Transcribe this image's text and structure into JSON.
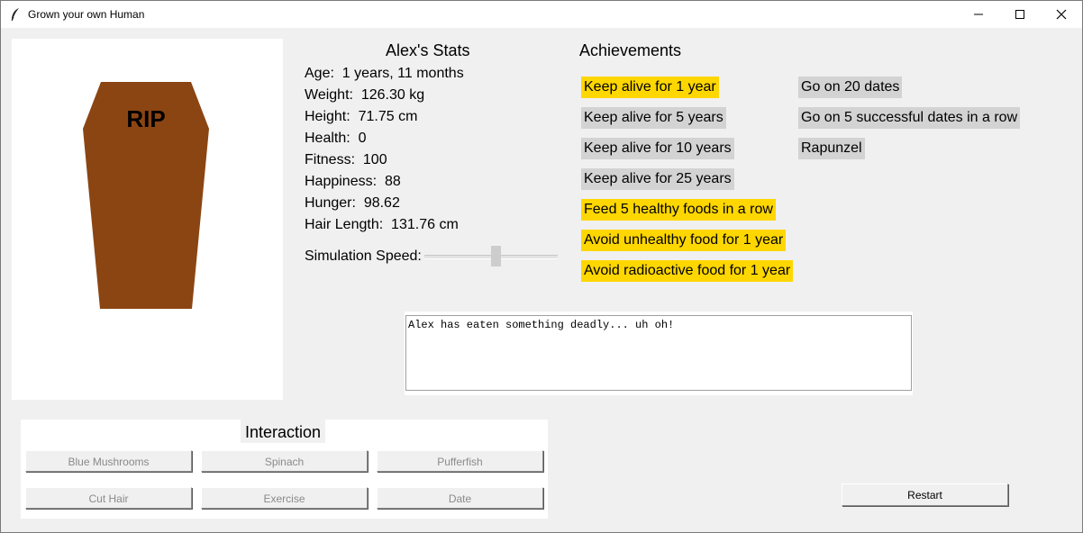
{
  "window": {
    "title": "Grown your own Human"
  },
  "canvas": {
    "tombstone_text": "RIP",
    "coffin_color": "#8b4513"
  },
  "stats": {
    "heading": "Alex's Stats",
    "age": "Age:  1 years, 11 months",
    "weight": "Weight:  126.30 kg",
    "height": "Height:  71.75 cm",
    "health": "Health:  0",
    "fitness": "Fitness:  100",
    "happiness": "Happiness:  88",
    "hunger": "Hunger:  98.62",
    "hair_length": "Hair Length:  131.76 cm",
    "speed_label": "Simulation Speed:",
    "speed_value": 0.5
  },
  "achievements": {
    "heading": "Achievements",
    "unlocked_color": "#ffd700",
    "locked_color": "#d3d3d3",
    "items": [
      {
        "label": "Keep alive for 1 year",
        "unlocked": true
      },
      {
        "label": "Keep alive for 5 years",
        "unlocked": false
      },
      {
        "label": "Keep alive for 10 years",
        "unlocked": false
      },
      {
        "label": "Keep alive for 25 years",
        "unlocked": false
      },
      {
        "label": "Feed 5 healthy foods in a row",
        "unlocked": true
      },
      {
        "label": "Avoid unhealthy food for 1 year",
        "unlocked": true
      },
      {
        "label": "Avoid radioactive food for 1 year",
        "unlocked": true
      },
      {
        "label": "Go on 20 dates",
        "unlocked": false
      },
      {
        "label": "Go on 5 successful dates in a row",
        "unlocked": false
      },
      {
        "label": "Rapunzel",
        "unlocked": false
      }
    ]
  },
  "log": {
    "text": "Alex has eaten something deadly... uh oh!"
  },
  "interaction": {
    "heading": "Interaction",
    "buttons": [
      "Blue Mushrooms",
      "Spinach",
      "Pufferfish",
      "Cut Hair",
      "Exercise",
      "Date"
    ]
  },
  "restart_label": "Restart"
}
